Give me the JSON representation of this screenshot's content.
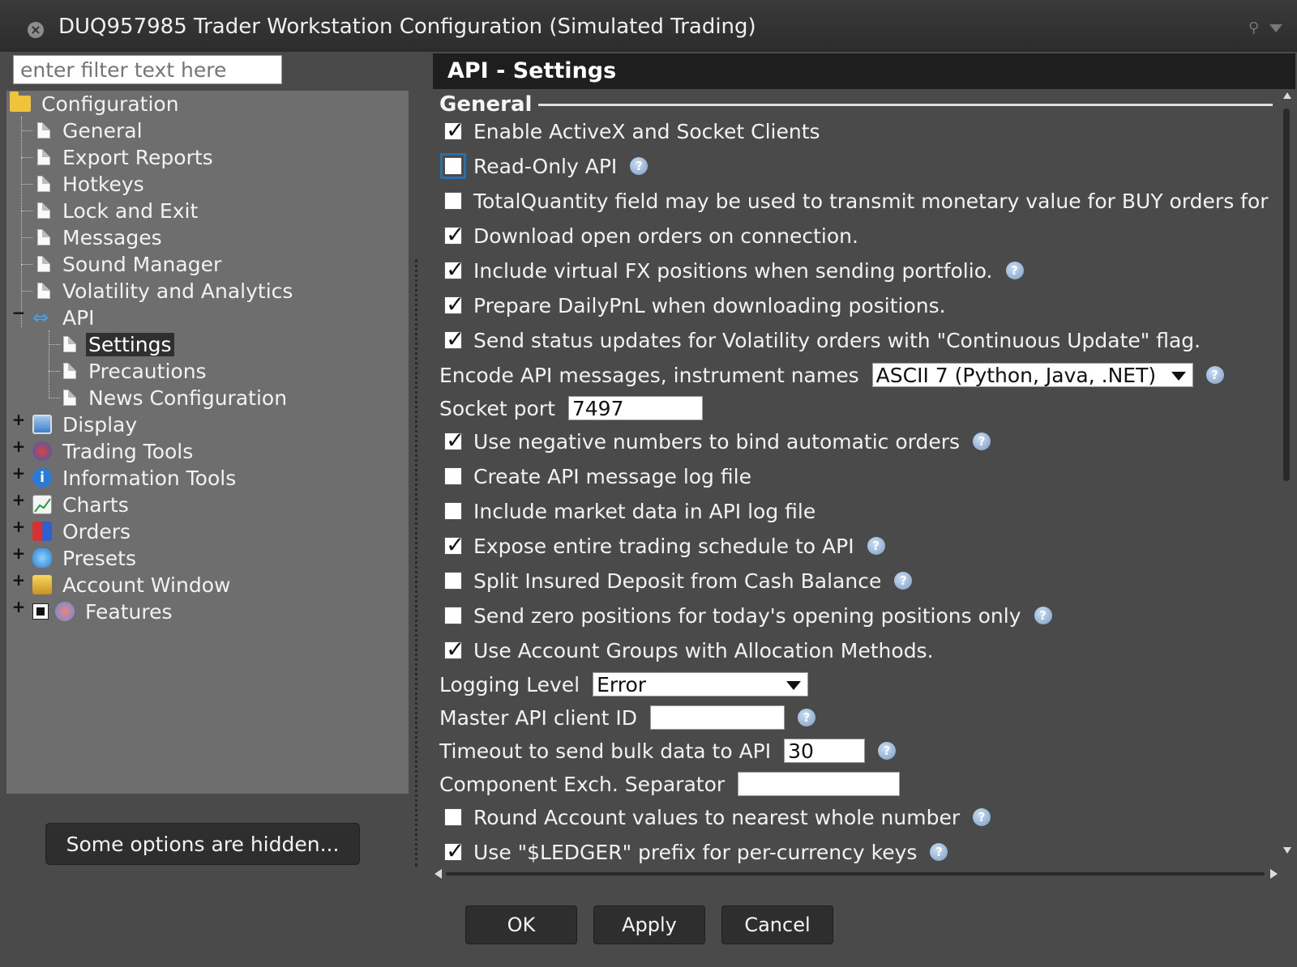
{
  "window": {
    "title": "DUQ957985 Trader Workstation Configuration (Simulated Trading)",
    "close_icon": "close-icon",
    "pin_icon": "pin-icon"
  },
  "filter": {
    "placeholder": "enter filter text here"
  },
  "tree": {
    "root": "Configuration",
    "items": [
      {
        "label": "General"
      },
      {
        "label": "Export Reports"
      },
      {
        "label": "Hotkeys"
      },
      {
        "label": "Lock and Exit"
      },
      {
        "label": "Messages"
      },
      {
        "label": "Sound Manager"
      },
      {
        "label": "Volatility and Analytics"
      },
      {
        "label": "API"
      },
      {
        "label": "Settings"
      },
      {
        "label": "Precautions"
      },
      {
        "label": "News Configuration"
      },
      {
        "label": "Display"
      },
      {
        "label": "Trading Tools"
      },
      {
        "label": "Information Tools"
      },
      {
        "label": "Charts"
      },
      {
        "label": "Orders"
      },
      {
        "label": "Presets"
      },
      {
        "label": "Account Window"
      },
      {
        "label": "Features"
      }
    ]
  },
  "hidden_options_label": "Some options are hidden...",
  "panel": {
    "title": "API - Settings",
    "section": "General",
    "checks": [
      {
        "label": "Enable ActiveX and Socket Clients",
        "checked": true
      },
      {
        "label": "Read-Only API",
        "checked": false
      },
      {
        "label": "TotalQuantity field may be used to transmit monetary value for BUY orders for",
        "checked": false
      },
      {
        "label": "Download open orders on connection.",
        "checked": true
      },
      {
        "label": "Include virtual FX positions when sending portfolio.",
        "checked": true
      },
      {
        "label": "Prepare DailyPnL when downloading positions.",
        "checked": true
      },
      {
        "label": "Send status updates for Volatility orders with \"Continuous Update\" flag.",
        "checked": true
      },
      {
        "label": "Use negative numbers to bind automatic orders",
        "checked": true
      },
      {
        "label": "Create API message log file",
        "checked": false
      },
      {
        "label": "Include market data in API log file",
        "checked": false
      },
      {
        "label": "Expose entire trading schedule to API",
        "checked": true
      },
      {
        "label": "Split Insured Deposit from Cash Balance",
        "checked": false
      },
      {
        "label": "Send zero positions for today's opening positions only",
        "checked": false
      },
      {
        "label": "Use Account Groups with Allocation Methods.",
        "checked": true
      },
      {
        "label": "Round Account values to nearest whole number",
        "checked": false
      },
      {
        "label": "Use \"$LEDGER\" prefix for per-currency keys",
        "checked": true
      }
    ],
    "encode": {
      "label": "Encode API messages, instrument names",
      "value": "ASCII 7 (Python, Java, .NET)"
    },
    "socket_port": {
      "label": "Socket port",
      "value": "7497"
    },
    "logging": {
      "label": "Logging Level",
      "value": "Error"
    },
    "master_client": {
      "label": "Master API client ID",
      "value": ""
    },
    "timeout": {
      "label": "Timeout to send bulk data to API",
      "value": "30"
    },
    "separator": {
      "label": "Component Exch. Separator",
      "value": ""
    },
    "help_icon": "help-icon"
  },
  "buttons": {
    "ok": "OK",
    "apply": "Apply",
    "cancel": "Cancel"
  }
}
